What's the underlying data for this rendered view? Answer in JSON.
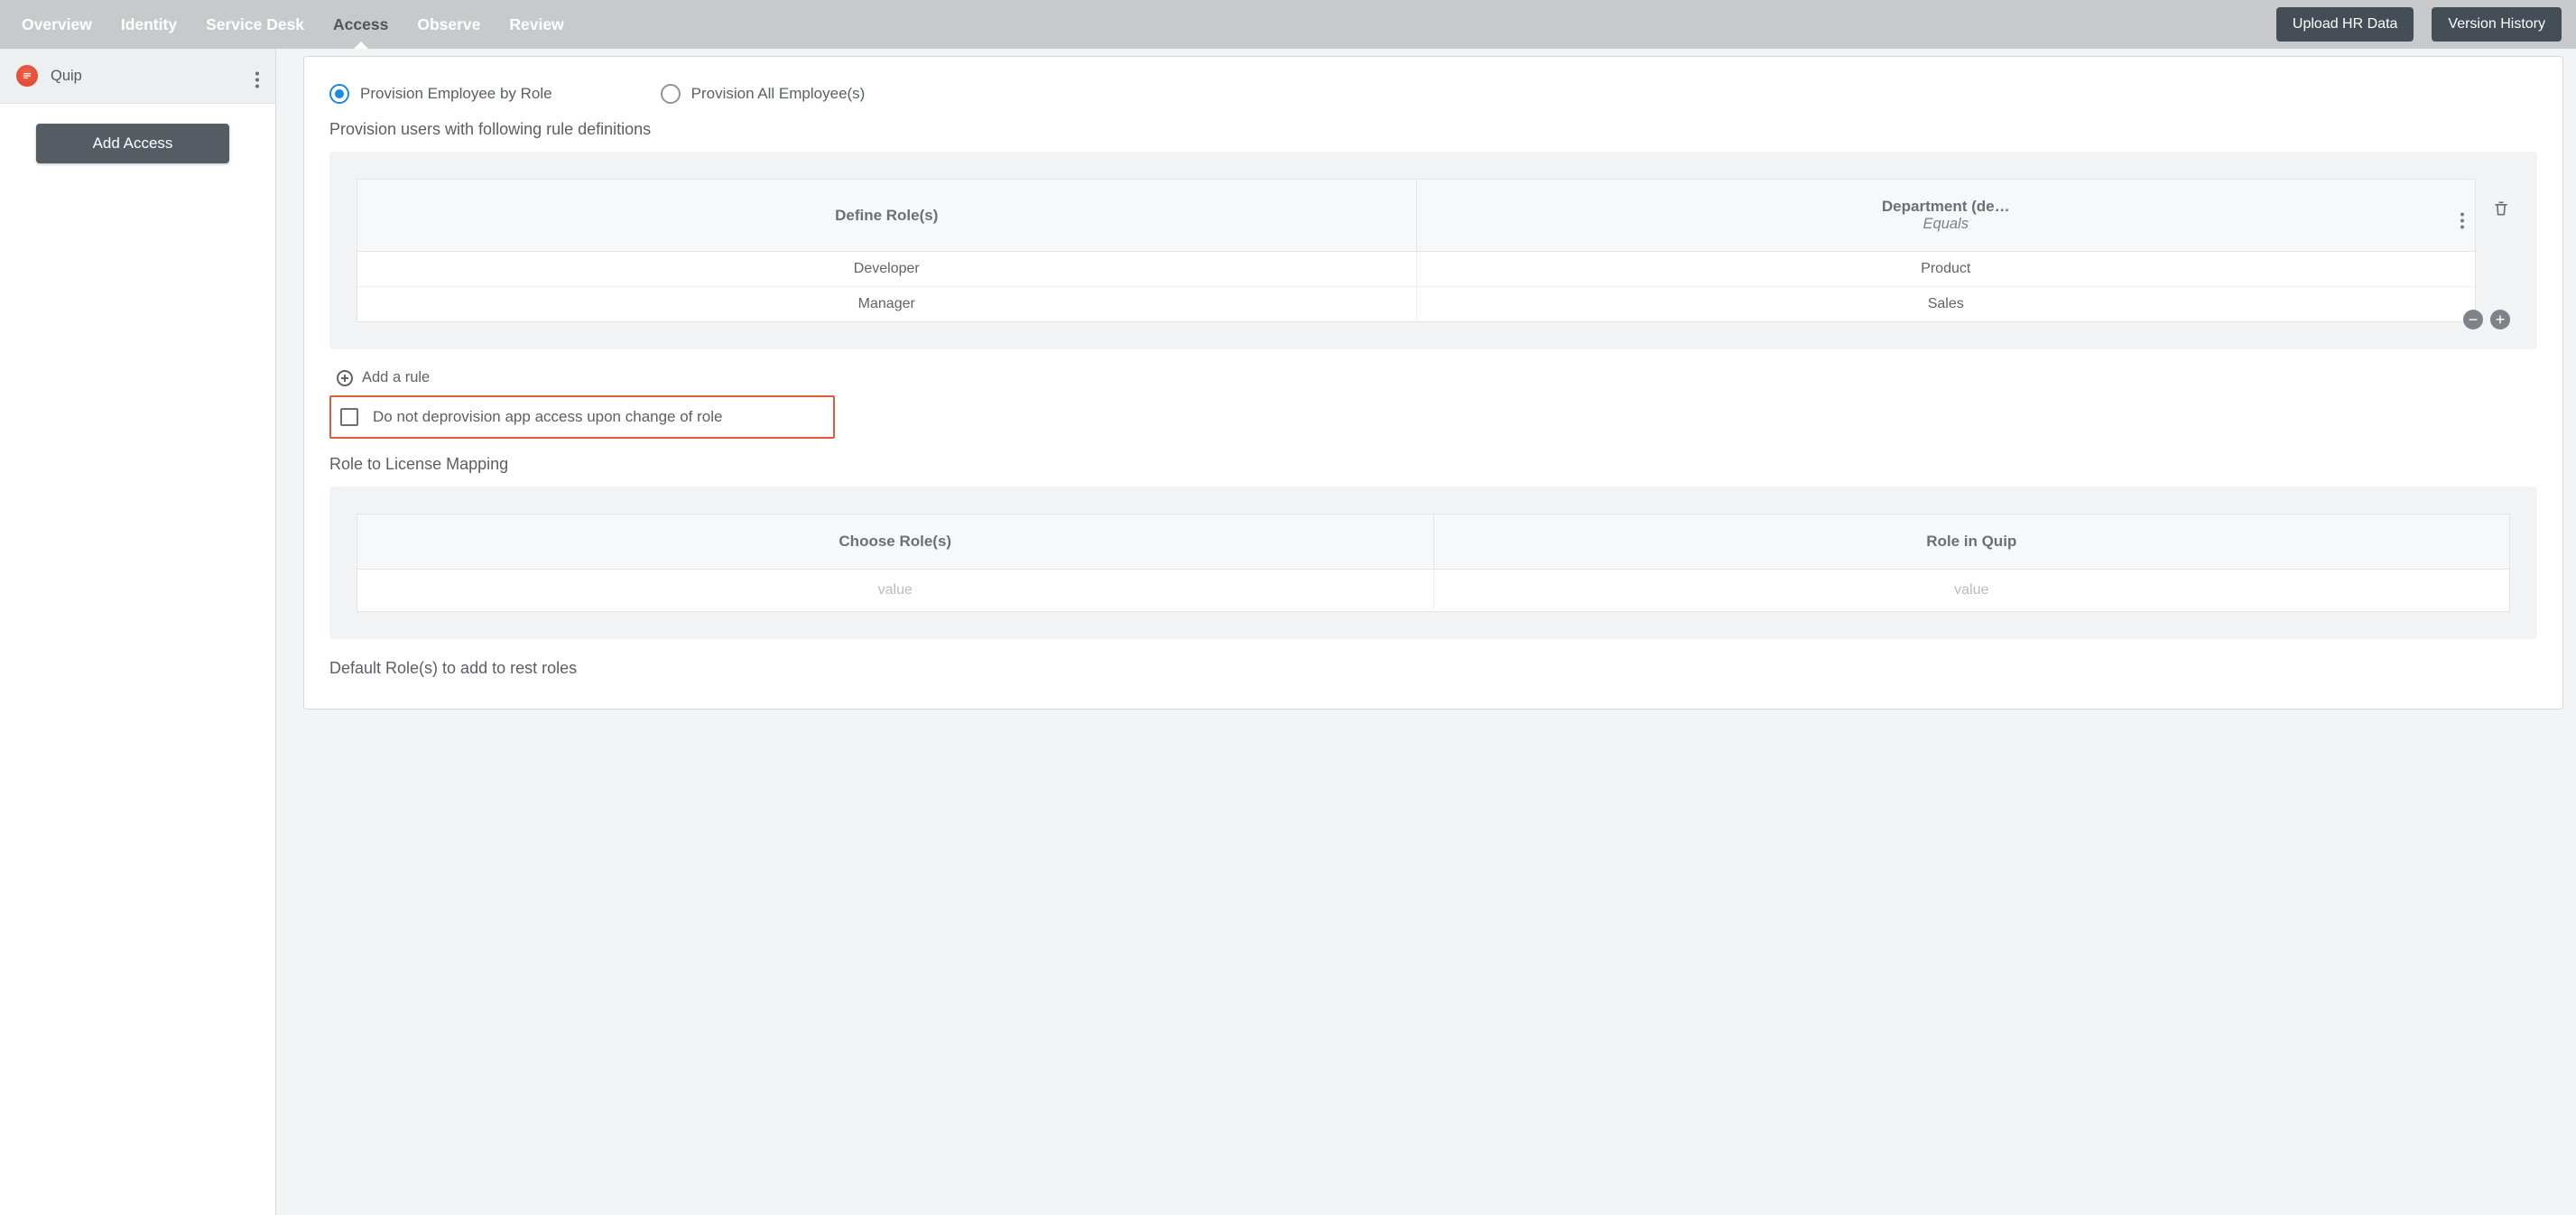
{
  "topnav": {
    "tabs": [
      "Overview",
      "Identity",
      "Service Desk",
      "Access",
      "Observe",
      "Review"
    ],
    "active_index": 3,
    "upload_btn": "Upload HR Data",
    "version_btn": "Version History"
  },
  "sidebar": {
    "app_name": "Quip",
    "add_access_btn": "Add Access"
  },
  "panel": {
    "radios": {
      "by_role": "Provision Employee by Role",
      "all": "Provision All Employee(s)",
      "selected": "by_role"
    },
    "provision_title": "Provision users with following rule definitions",
    "rule_table": {
      "col1": "Define Role(s)",
      "col2": "Department (de…",
      "col2_sub": "Equals",
      "rows": [
        {
          "role": "Developer",
          "dept": "Product"
        },
        {
          "role": "Manager",
          "dept": "Sales"
        }
      ]
    },
    "add_rule": "Add a rule",
    "deprovision_checkbox": "Do not deprovision app access upon change of role",
    "mapping_title": "Role to License Mapping",
    "mapping_table": {
      "col1": "Choose Role(s)",
      "col2": "Role in Quip",
      "placeholder": "value"
    },
    "default_roles_title": "Default Role(s) to add to rest roles"
  }
}
